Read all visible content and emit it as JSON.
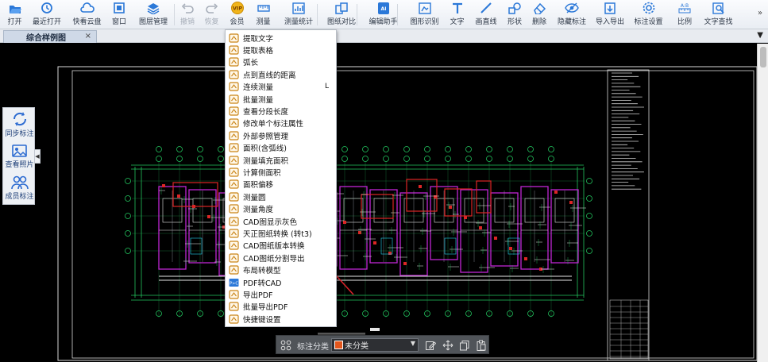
{
  "toolbar": {
    "items": [
      {
        "label": "打开",
        "icon": "folder-open-icon",
        "enabled": true
      },
      {
        "label": "最近打开",
        "icon": "history-clock-icon",
        "enabled": true
      },
      {
        "label": "快看云盘",
        "icon": "cloud-icon",
        "enabled": true
      },
      {
        "label": "窗口",
        "icon": "window-icon",
        "enabled": true
      },
      {
        "label": "图层管理",
        "icon": "layers-icon",
        "enabled": true
      },
      {
        "label": "撤销",
        "icon": "undo-icon",
        "enabled": false
      },
      {
        "label": "恢复",
        "icon": "redo-icon",
        "enabled": false
      },
      {
        "label": "会员",
        "icon": "vip-badge-icon",
        "enabled": true
      },
      {
        "label": "测量",
        "icon": "measure-ruler-icon",
        "enabled": true
      },
      {
        "label": "测量统计",
        "icon": "measure-stats-icon",
        "enabled": true
      },
      {
        "label": "图纸对比",
        "icon": "compare-icon",
        "enabled": true
      },
      {
        "label": "编辑助手",
        "icon": "edit-assistant-icon",
        "enabled": true
      },
      {
        "label": "图形识别",
        "icon": "shape-recognize-icon",
        "enabled": true
      },
      {
        "label": "文字",
        "icon": "text-tool-icon",
        "enabled": true
      },
      {
        "label": "画直线",
        "icon": "draw-line-icon",
        "enabled": true
      },
      {
        "label": "形状",
        "icon": "shape-icon",
        "enabled": true
      },
      {
        "label": "删除",
        "icon": "eraser-icon",
        "enabled": true
      },
      {
        "label": "隐藏标注",
        "icon": "hide-eye-icon",
        "enabled": true
      },
      {
        "label": "导入导出",
        "icon": "import-export-icon",
        "enabled": true
      },
      {
        "label": "标注设置",
        "icon": "annotation-settings-icon",
        "enabled": true
      },
      {
        "label": "比例",
        "icon": "scale-ratio-icon",
        "enabled": true
      },
      {
        "label": "文字查找",
        "icon": "text-search-icon",
        "enabled": true
      }
    ],
    "overflow": "»",
    "vip_text": "VIP"
  },
  "tabs": {
    "active": "综合样例图",
    "close": "×",
    "menu": "▼"
  },
  "sidepanel": {
    "items": [
      {
        "label": "同步标注",
        "icon": "sync-icon"
      },
      {
        "label": "查看照片",
        "icon": "photo-icon"
      },
      {
        "label": "成员标注",
        "icon": "members-icon"
      }
    ],
    "toggle": "◀"
  },
  "menu": {
    "items": [
      {
        "label": "提取文字",
        "icon": "extract-text-icon",
        "shortcut": ""
      },
      {
        "label": "提取表格",
        "icon": "extract-table-icon",
        "shortcut": ""
      },
      {
        "label": "弧长",
        "icon": "arc-length-icon",
        "shortcut": ""
      },
      {
        "label": "点到直线的距离",
        "icon": "point-line-distance-icon",
        "shortcut": ""
      },
      {
        "label": "连续测量",
        "icon": "continuous-measure-icon",
        "shortcut": "L"
      },
      {
        "label": "批量测量",
        "icon": "batch-measure-icon",
        "shortcut": ""
      },
      {
        "label": "查看分段长度",
        "icon": "segment-length-icon",
        "shortcut": ""
      },
      {
        "label": "修改单个标注属性",
        "icon": "edit-annotation-icon",
        "shortcut": ""
      },
      {
        "label": "外部参照管理",
        "icon": "xref-manage-icon",
        "shortcut": ""
      },
      {
        "label": "面积(含弧线)",
        "icon": "area-arc-icon",
        "shortcut": ""
      },
      {
        "label": "测量填充面积",
        "icon": "fill-area-icon",
        "shortcut": ""
      },
      {
        "label": "计算侧面积",
        "icon": "side-area-icon",
        "shortcut": ""
      },
      {
        "label": "面积偏移",
        "icon": "area-offset-icon",
        "shortcut": ""
      },
      {
        "label": "测量圆",
        "icon": "measure-circle-icon",
        "shortcut": ""
      },
      {
        "label": "测量角度",
        "icon": "measure-angle-icon",
        "shortcut": ""
      },
      {
        "label": "CAD图显示灰色",
        "icon": "gray-display-icon",
        "shortcut": ""
      },
      {
        "label": "天正图纸转换 (转t3)",
        "icon": "tangent-convert-icon",
        "shortcut": ""
      },
      {
        "label": "CAD图纸版本转换",
        "icon": "version-convert-icon",
        "shortcut": ""
      },
      {
        "label": "CAD图纸分割导出",
        "icon": "split-export-icon",
        "shortcut": ""
      },
      {
        "label": "布局转模型",
        "icon": "layout-to-model-icon",
        "shortcut": ""
      },
      {
        "label": "PDF转CAD",
        "icon": "pdf-to-cad-icon",
        "shortcut": ""
      },
      {
        "label": "导出PDF",
        "icon": "export-pdf-icon",
        "shortcut": ""
      },
      {
        "label": "批量导出PDF",
        "icon": "batch-export-pdf-icon",
        "shortcut": ""
      },
      {
        "label": "快捷键设置",
        "icon": "shortcut-settings-icon",
        "shortcut": ""
      }
    ]
  },
  "bottombar": {
    "label": "标注分类",
    "select_value": "未分类",
    "swatch_color": "#e2561c"
  },
  "colors": {
    "canvas_bg": "#000000",
    "cad_green": "#22c55e",
    "cad_magenta": "#c026d3",
    "cad_red": "#dc2626",
    "annotation_arrow": "#d8222a"
  }
}
